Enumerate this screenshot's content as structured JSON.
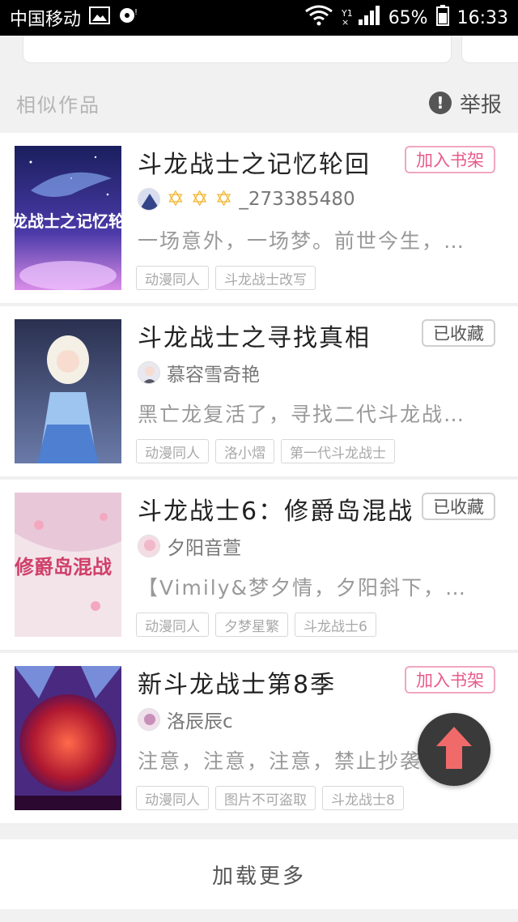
{
  "status_bar": {
    "carrier": "中国移动",
    "network_top": "Y1",
    "network_bottom": "×",
    "battery": "65%",
    "time": "16:33",
    "icons": [
      "image-icon",
      "media-icon",
      "wifi-icon",
      "signal-icon",
      "battery-icon"
    ]
  },
  "section": {
    "title": "相似作品",
    "report_label": "举报",
    "report_icon": "alert-icon"
  },
  "books": [
    {
      "title": "斗龙战士之记忆轮回",
      "button": "加入书架",
      "button_state": "add",
      "author": "_273385480",
      "stars": [
        "✡",
        "✡",
        "✡"
      ],
      "description": "一场意外，一场梦。前世今生，…",
      "tags": [
        "动漫同人",
        "斗龙战士改写"
      ],
      "cover_text": "斗龙战士之记忆轮回"
    },
    {
      "title": "斗龙战士之寻找真相",
      "button": "已收藏",
      "button_state": "saved",
      "author": "慕容雪奇艳",
      "stars": [],
      "description": "黑亡龙复活了，寻找二代斗龙战…",
      "tags": [
        "动漫同人",
        "洛小熠",
        "第一代斗龙战士"
      ],
      "cover_text": ""
    },
    {
      "title": "斗龙战士6：修爵岛混战",
      "button": "已收藏",
      "button_state": "saved",
      "author": "夕阳音萱",
      "stars": [],
      "description": "【Vimily&梦夕情，夕阳斜下，…",
      "tags": [
        "动漫同人",
        "夕梦星繁",
        "斗龙战士6"
      ],
      "cover_text": "修爵岛混战"
    },
    {
      "title": "新斗龙战士第8季",
      "button": "加入书架",
      "button_state": "add",
      "author": "洛辰辰c",
      "stars": [],
      "description": "注意，注意，注意，禁止抄袭…",
      "tags": [
        "动漫同人",
        "图片不可盗取",
        "斗龙战士8"
      ],
      "cover_text": ""
    }
  ],
  "load_more": "加载更多",
  "fab_icon": "arrow-up-icon",
  "colors": {
    "accent_pink": "#e85b8a",
    "fab_bg": "#3a3a3a",
    "fab_arrow": "#f06a6a",
    "star": "#f2b531"
  }
}
